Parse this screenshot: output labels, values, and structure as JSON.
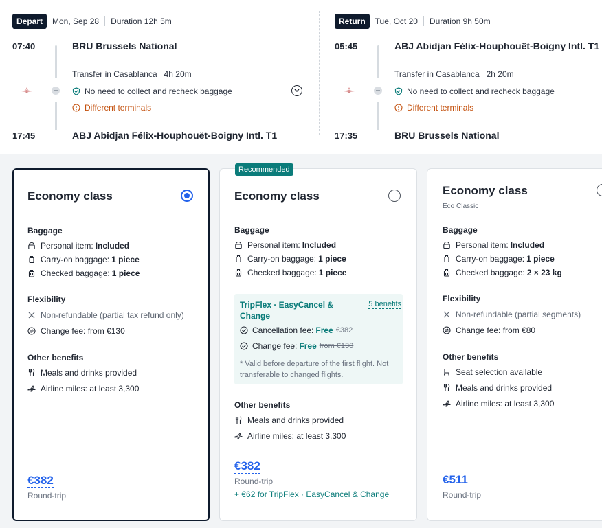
{
  "depart": {
    "badge": "Depart",
    "date": "Mon, Sep 28",
    "duration": "Duration 12h 5m",
    "dep_time": "07:40",
    "dep_airport": "BRU Brussels National",
    "transfer": "Transfer in Casablanca",
    "transfer_duration": "4h 20m",
    "baggage_note": "No need to collect and recheck baggage",
    "terminal_note": "Different terminals",
    "arr_time": "17:45",
    "arr_airport": "ABJ Abidjan Félix-Houphouët-Boigny Intl. T1"
  },
  "return": {
    "badge": "Return",
    "date": "Tue, Oct 20",
    "duration": "Duration 9h 50m",
    "dep_time": "05:45",
    "dep_airport": "ABJ Abidjan Félix-Houphouët-Boigny Intl. T1",
    "transfer": "Transfer in Casablanca",
    "transfer_duration": "2h 20m",
    "baggage_note": "No need to collect and recheck baggage",
    "terminal_note": "Different terminals",
    "arr_time": "17:35",
    "arr_airport": "BRU Brussels National"
  },
  "fares": [
    {
      "title": "Economy class",
      "selected": true,
      "baggage_title": "Baggage",
      "personal_label": "Personal item:",
      "personal_value": "Included",
      "carryon_label": "Carry-on baggage:",
      "carryon_value": "1 piece",
      "checked_label": "Checked baggage:",
      "checked_value": "1 piece",
      "flex_title": "Flexibility",
      "refund": "Non-refundable (partial tax refund only)",
      "change_fee": "Change fee: from €130",
      "benefits_title": "Other benefits",
      "benefit_1": "Meals and drinks provided",
      "benefit_2": "Airline miles: at least 3,300",
      "price": "€382",
      "price_sub": "Round-trip"
    },
    {
      "badge": "Recommended",
      "title": "Economy class",
      "selected": false,
      "baggage_title": "Baggage",
      "personal_label": "Personal item:",
      "personal_value": "Included",
      "carryon_label": "Carry-on baggage:",
      "carryon_value": "1 piece",
      "checked_label": "Checked baggage:",
      "checked_value": "1 piece",
      "tripflex_title": "TripFlex · EasyCancel & Change",
      "tripflex_link": "5 benefits",
      "cancel_label": "Cancellation fee:",
      "cancel_free": "Free",
      "cancel_old": "€382",
      "changefee_label": "Change fee:",
      "changefee_free": "Free",
      "changefee_old": "from €130",
      "tripflex_note": "* Valid before departure of the first flight. Not transferable to changed flights.",
      "benefits_title": "Other benefits",
      "benefit_1": "Meals and drinks provided",
      "benefit_2": "Airline miles: at least 3,300",
      "price": "€382",
      "price_sub": "Round-trip",
      "addon": "+ €62 for TripFlex · EasyCancel & Change"
    },
    {
      "title": "Economy class",
      "subtitle": "Eco Classic",
      "selected": false,
      "baggage_title": "Baggage",
      "personal_label": "Personal item:",
      "personal_value": "Included",
      "carryon_label": "Carry-on baggage:",
      "carryon_value": "1 piece",
      "checked_label": "Checked baggage:",
      "checked_value": "2 × 23 kg",
      "flex_title": "Flexibility",
      "refund": "Non-refundable (partial segments)",
      "change_fee": "Change fee: from €80",
      "benefits_title": "Other benefits",
      "benefit_1": "Seat selection available",
      "benefit_2": "Meals and drinks provided",
      "benefit_3": "Airline miles: at least 3,300",
      "price": "€511",
      "price_sub": "Round-trip"
    }
  ],
  "colors": {
    "accent": "#2463eb",
    "teal": "#0b7c7a",
    "warning": "#c4520f",
    "dark": "#0f1b2d"
  }
}
